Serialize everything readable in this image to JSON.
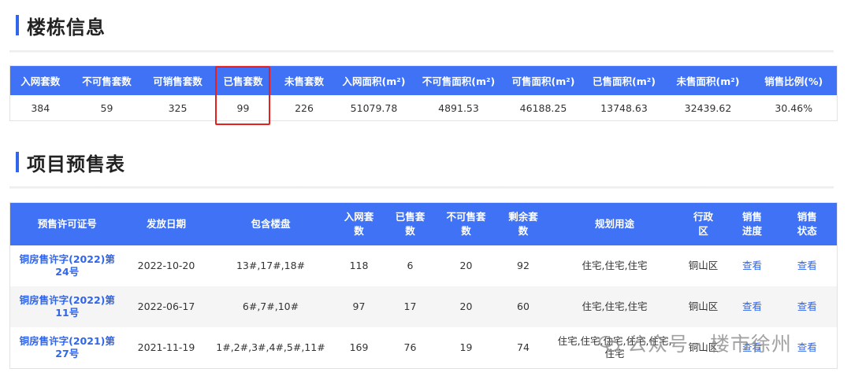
{
  "building": {
    "title": "楼栋信息",
    "headers": [
      "入网套数",
      "不可售套数",
      "可销售套数",
      "已售套数",
      "未售套数",
      "入网面积(m²)",
      "不可售面积(m²)",
      "可售面积(m²)",
      "已售面积(m²)",
      "未售面积(m²)",
      "销售比例(%)"
    ],
    "values": [
      "384",
      "59",
      "325",
      "99",
      "226",
      "51079.78",
      "4891.53",
      "46188.25",
      "13748.63",
      "32439.62",
      "30.46%"
    ]
  },
  "presale": {
    "title": "项目预售表",
    "headers": [
      "预售许可证号",
      "发放日期",
      "包含楼盘",
      "入网套数",
      "已售套数",
      "不可售套数",
      "剩余套数",
      "规划用途",
      "行政区",
      "销售进度",
      "销售状态"
    ],
    "rows": [
      {
        "permit": "铜房售许字(2022)第24号",
        "date": "2022-10-20",
        "buildings": "13#,17#,18#",
        "net": "118",
        "sold": "6",
        "unsellable": "20",
        "remain": "92",
        "usage": "住宅,住宅,住宅",
        "district": "铜山区",
        "progress": "查看",
        "status": "查看"
      },
      {
        "permit": "铜房售许字(2022)第11号",
        "date": "2022-06-17",
        "buildings": "6#,7#,10#",
        "net": "97",
        "sold": "17",
        "unsellable": "20",
        "remain": "60",
        "usage": "住宅,住宅,住宅",
        "district": "铜山区",
        "progress": "查看",
        "status": "查看"
      },
      {
        "permit": "铜房售许字(2021)第27号",
        "date": "2021-11-19",
        "buildings": "1#,2#,3#,4#,5#,11#",
        "net": "169",
        "sold": "76",
        "unsellable": "19",
        "remain": "74",
        "usage": "住宅,住宅,住宅,住宅,住宅,住宅",
        "district": "铜山区",
        "progress": "查看",
        "status": "查看"
      }
    ]
  },
  "watermark": "公众号 · 楼市徐州",
  "colors": {
    "header_bg": "#3f72f5",
    "accent": "#2f66ec",
    "highlight": "#e5201f"
  }
}
